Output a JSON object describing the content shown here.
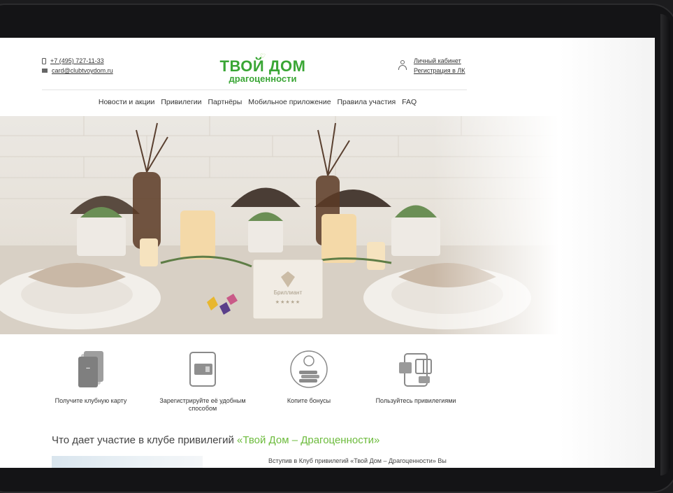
{
  "header": {
    "phone": "+7 (495) 727-11-33",
    "email": "card@clubtvoydom.ru",
    "logo_gem": "♡",
    "logo_main": "ТВОЙ ДОМ",
    "logo_sub": "драгоценности",
    "account_link": "Личный кабинет",
    "register_link": "Регистрация в ЛК"
  },
  "nav": {
    "items": [
      "Новости и акции",
      "Привилегии",
      "Партнёры",
      "Мобильное приложение",
      "Правила участия",
      "FAQ"
    ]
  },
  "hero": {
    "card_text": "Бриллиант",
    "card_stars": "★★★★★"
  },
  "steps": [
    {
      "icon": "club-card-icon",
      "label": "Получите клубную карту"
    },
    {
      "icon": "tablet-register-icon",
      "label": "Зарегистрируйте её удобным способом"
    },
    {
      "icon": "coins-stack-icon",
      "label": "Копите бонусы"
    },
    {
      "icon": "gift-phone-icon",
      "label": "Пользуйтесь привилегиями"
    }
  ],
  "section": {
    "title_plain": "Что дает участие в клубе привилегий ",
    "title_accent": "«Твой Дом – Драгоценности»",
    "text_line": "Вступив в Клуб привилегий «Твой Дом – Драгоценности» Вы"
  },
  "colors": {
    "brand_green": "#3aa635",
    "accent_green": "#6cbb3c",
    "bezel": "#141416"
  }
}
